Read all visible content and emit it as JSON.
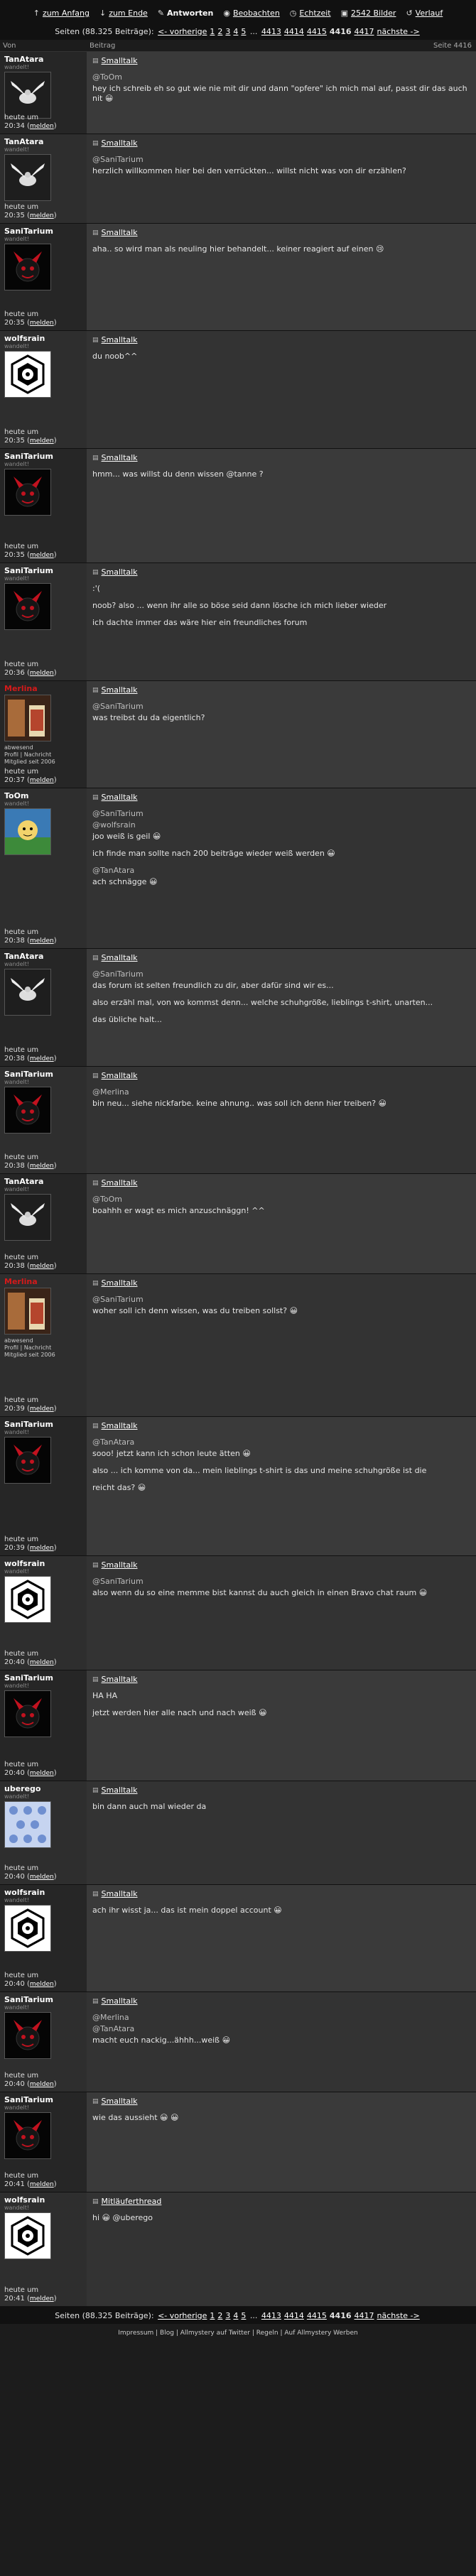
{
  "topnav": {
    "items": [
      {
        "icon": "arrow-up-icon",
        "label": "zum Anfang",
        "active": false
      },
      {
        "icon": "arrow-down-icon",
        "label": "zum Ende",
        "active": false
      },
      {
        "icon": "reply-icon",
        "label": "Antworten",
        "active": true
      },
      {
        "icon": "eye-icon",
        "label": "Beobachten",
        "active": false
      },
      {
        "icon": "clock-icon",
        "label": "Echtzeit",
        "active": false
      },
      {
        "icon": "image-icon",
        "label": "2542 Bilder",
        "active": false
      },
      {
        "icon": "history-icon",
        "label": "Verlauf",
        "active": false
      }
    ]
  },
  "pager": {
    "prefix": "Seiten (88.325 Beiträge):",
    "prev": "<- vorherige",
    "pages": [
      "1",
      "2",
      "3",
      "4",
      "5"
    ],
    "ellipsis": "...",
    "near": [
      "4413",
      "4414",
      "4415"
    ],
    "current": "4416",
    "after": [
      "4417"
    ],
    "next": "nächste ->"
  },
  "columns": {
    "author": "Von",
    "post": "Beitrag",
    "page": "Seite 4416"
  },
  "posts": [
    {
      "user": "TanAtara",
      "red": false,
      "title": "wandelt!",
      "avatar": "dove",
      "date": "heute um",
      "time": "20:34",
      "melden": "melden",
      "subject": "Smalltalk",
      "extra": [],
      "lines": [
        {
          "q": true,
          "t": "@ToOm"
        },
        {
          "q": false,
          "t": "hey ich schreib eh so gut wie nie mit dir und dann \"opfere\" ich mich mal auf, passt dir das auch nit 😀"
        }
      ]
    },
    {
      "user": "TanAtara",
      "red": false,
      "title": "wandelt!",
      "avatar": "dove",
      "date": "heute um",
      "time": "20:35",
      "melden": "melden",
      "subject": "Smalltalk",
      "extra": [],
      "lines": [
        {
          "q": true,
          "t": "@SaniTarium"
        },
        {
          "q": false,
          "t": "herzlich willkommen hier bei den verrückten... willst nicht was von dir erzählen?"
        }
      ]
    },
    {
      "user": "SaniTarium",
      "red": false,
      "title": "wandelt!",
      "avatar": "devil",
      "date": "heute um",
      "time": "20:35",
      "melden": "melden",
      "subject": "Smalltalk",
      "extra": [],
      "lines": [
        {
          "q": false,
          "t": "aha.. so wird man als neuling hier behandelt... keiner reagiert auf einen 😢"
        }
      ]
    },
    {
      "user": "wolfsrain",
      "red": false,
      "title": "wandelt!",
      "avatar": "dharma",
      "date": "heute um",
      "time": "20:35",
      "melden": "melden",
      "subject": "Smalltalk",
      "extra": [],
      "lines": [
        {
          "q": false,
          "t": "du noob^^"
        }
      ]
    },
    {
      "user": "SaniTarium",
      "red": false,
      "title": "wandelt!",
      "avatar": "devil",
      "date": "heute um",
      "time": "20:35",
      "melden": "melden",
      "subject": "Smalltalk",
      "extra": [],
      "lines": [
        {
          "q": false,
          "t": "hmm... was willst du denn wissen @tanne ?"
        }
      ]
    },
    {
      "user": "SaniTarium",
      "red": false,
      "title": "wandelt!",
      "avatar": "devil",
      "date": "heute um",
      "time": "20:36",
      "melden": "melden",
      "subject": "Smalltalk",
      "extra": [],
      "lines": [
        {
          "q": false,
          "t": ":'("
        },
        {
          "q": false,
          "t": "noob? also ... wenn ihr alle so böse seid dann lösche ich mich lieber wieder"
        },
        {
          "q": false,
          "t": "ich dachte immer das wäre hier ein freundliches forum"
        }
      ]
    },
    {
      "user": "Merlina",
      "red": true,
      "title": "",
      "avatar": "drink",
      "date": "heute um",
      "time": "20:37",
      "melden": "melden",
      "subject": "Smalltalk",
      "extra": [
        "abwesend",
        "Profil | Nachricht",
        "Mitglied seit 2006"
      ],
      "lines": [
        {
          "q": true,
          "t": "@SaniTarium"
        },
        {
          "q": false,
          "t": "was treibst du da eigentlich?"
        }
      ]
    },
    {
      "user": "ToOm",
      "red": false,
      "title": "wandelt!",
      "avatar": "cartoon",
      "date": "heute um",
      "time": "20:38",
      "melden": "melden",
      "subject": "Smalltalk",
      "extra": [],
      "lines": [
        {
          "q": true,
          "t": "@SaniTarium"
        },
        {
          "q": true,
          "t": "@wolfsrain"
        },
        {
          "q": false,
          "t": "joo weiß is geil 😀"
        },
        {
          "q": false,
          "t": "ich finde man sollte nach 200 beiträge wieder weiß werden 😀"
        },
        {
          "q": true,
          "t": "@TanAtara"
        },
        {
          "q": false,
          "t": "ach schnägge 😀"
        }
      ]
    },
    {
      "user": "TanAtara",
      "red": false,
      "title": "wandelt!",
      "avatar": "dove",
      "date": "heute um",
      "time": "20:38",
      "melden": "melden",
      "subject": "Smalltalk",
      "extra": [],
      "lines": [
        {
          "q": true,
          "t": "@SaniTarium"
        },
        {
          "q": false,
          "t": "das forum ist selten freundlich zu dir, aber dafür sind wir es..."
        },
        {
          "q": false,
          "t": "also erzähl mal, von wo kommst denn... welche schuhgröße, lieblings t-shirt, unarten..."
        },
        {
          "q": false,
          "t": "das übliche halt..."
        }
      ]
    },
    {
      "user": "SaniTarium",
      "red": false,
      "title": "wandelt!",
      "avatar": "devil",
      "date": "heute um",
      "time": "20:38",
      "melden": "melden",
      "subject": "Smalltalk",
      "extra": [],
      "lines": [
        {
          "q": true,
          "t": "@Merlina"
        },
        {
          "q": false,
          "t": "bin neu... siehe nickfarbe. keine ahnung.. was soll ich denn hier treiben? 😀"
        }
      ]
    },
    {
      "user": "TanAtara",
      "red": false,
      "title": "wandelt!",
      "avatar": "dove",
      "date": "heute um",
      "time": "20:38",
      "melden": "melden",
      "subject": "Smalltalk",
      "extra": [],
      "lines": [
        {
          "q": true,
          "t": "@ToOm"
        },
        {
          "q": false,
          "t": "boahhh er wagt es mich anzuschnäggn! ^^"
        }
      ]
    },
    {
      "user": "Merlina",
      "red": true,
      "title": "",
      "avatar": "drink",
      "date": "heute um",
      "time": "20:39",
      "melden": "melden",
      "subject": "Smalltalk",
      "extra": [
        "abwesend",
        "Profil | Nachricht",
        "Mitglied seit 2006"
      ],
      "lines": [
        {
          "q": true,
          "t": "@SaniTarium"
        },
        {
          "q": false,
          "t": "woher soll ich denn wissen, was du treiben sollst? 😀"
        }
      ]
    },
    {
      "user": "SaniTarium",
      "red": false,
      "title": "wandelt!",
      "avatar": "devil",
      "date": "heute um",
      "time": "20:39",
      "melden": "melden",
      "subject": "Smalltalk",
      "extra": [],
      "lines": [
        {
          "q": true,
          "t": "@TanAtara"
        },
        {
          "q": false,
          "t": "sooo! jetzt kann ich schon leute ätten 😀"
        },
        {
          "q": false,
          "t": "also ... ich komme von da... mein lieblings t-shirt is das und meine schuhgröße ist die"
        },
        {
          "q": false,
          "t": "reicht das? 😀"
        }
      ]
    },
    {
      "user": "wolfsrain",
      "red": false,
      "title": "wandelt!",
      "avatar": "dharma",
      "date": "heute um",
      "time": "20:40",
      "melden": "melden",
      "subject": "Smalltalk",
      "extra": [],
      "lines": [
        {
          "q": true,
          "t": "@SaniTarium"
        },
        {
          "q": false,
          "t": "also wenn du so eine memme bist kannst du auch gleich in einen Bravo chat raum 😀"
        }
      ]
    },
    {
      "user": "SaniTarium",
      "red": false,
      "title": "wandelt!",
      "avatar": "devil",
      "date": "heute um",
      "time": "20:40",
      "melden": "melden",
      "subject": "Smalltalk",
      "extra": [],
      "lines": [
        {
          "q": false,
          "t": "HA HA"
        },
        {
          "q": false,
          "t": "jetzt werden hier alle nach und nach weiß 😀"
        }
      ]
    },
    {
      "user": "uberego",
      "red": false,
      "title": "wandelt!",
      "avatar": "pattern",
      "date": "heute um",
      "time": "20:40",
      "melden": "melden",
      "subject": "Smalltalk",
      "extra": [],
      "lines": [
        {
          "q": false,
          "t": "bin dann auch mal wieder da"
        }
      ]
    },
    {
      "user": "wolfsrain",
      "red": false,
      "title": "wandelt!",
      "avatar": "dharma",
      "date": "heute um",
      "time": "20:40",
      "melden": "melden",
      "subject": "Smalltalk",
      "extra": [],
      "lines": [
        {
          "q": false,
          "t": "ach ihr wisst ja... das ist mein doppel account 😀"
        }
      ]
    },
    {
      "user": "SaniTarium",
      "red": false,
      "title": "wandelt!",
      "avatar": "devil",
      "date": "heute um",
      "time": "20:40",
      "melden": "melden",
      "subject": "Smalltalk",
      "extra": [],
      "lines": [
        {
          "q": true,
          "t": "@Merlina"
        },
        {
          "q": true,
          "t": "@TanAtara"
        },
        {
          "q": false,
          "t": "macht euch nackig...ähhh...weiß 😀"
        }
      ]
    },
    {
      "user": "SaniTarium",
      "red": false,
      "title": "wandelt!",
      "avatar": "devil",
      "date": "heute um",
      "time": "20:41",
      "melden": "melden",
      "subject": "Smalltalk",
      "extra": [],
      "lines": [
        {
          "q": false,
          "t": "wie das aussieht 😀 😀"
        }
      ]
    },
    {
      "user": "wolfsrain",
      "red": false,
      "title": "wandelt!",
      "avatar": "dharma",
      "date": "heute um",
      "time": "20:41",
      "melden": "melden",
      "subject": "Mitläuferthread",
      "extra": [],
      "lines": [
        {
          "q": false,
          "t": "hi 😀 @uberego"
        }
      ]
    }
  ],
  "postHeights": [
    115,
    125,
    150,
    165,
    160,
    165,
    150,
    225,
    165,
    150,
    140,
    200,
    195,
    160,
    155,
    145,
    150,
    140,
    140,
    160
  ],
  "footer": "Impressum | Blog | Allmystery auf Twitter | Regeln | Auf Allmystery Werben"
}
